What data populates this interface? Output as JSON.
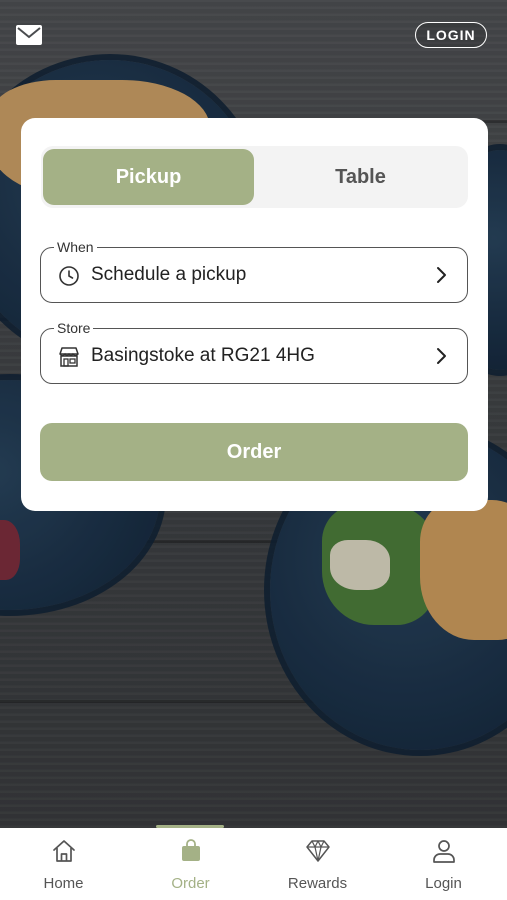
{
  "header": {
    "mail_icon": "mail-icon",
    "login_label": "LOGIN"
  },
  "order_card": {
    "tabs": [
      {
        "label": "Pickup",
        "selected": true
      },
      {
        "label": "Table",
        "selected": false
      }
    ],
    "when_field": {
      "legend": "When",
      "value": "Schedule a pickup",
      "icon": "clock-icon"
    },
    "store_field": {
      "legend": "Store",
      "value": "Basingstoke at RG21 4HG",
      "icon": "store-icon"
    },
    "order_button_label": "Order"
  },
  "bottom_nav": {
    "items": [
      {
        "label": "Home",
        "icon": "home-icon",
        "active": false
      },
      {
        "label": "Order",
        "icon": "shopping-bag-icon",
        "active": true
      },
      {
        "label": "Rewards",
        "icon": "diamond-icon",
        "active": false
      },
      {
        "label": "Login",
        "icon": "user-icon",
        "active": false
      }
    ]
  },
  "colors": {
    "accent": "#a4b186",
    "text_dark": "#222222",
    "card_bg": "#ffffff"
  }
}
